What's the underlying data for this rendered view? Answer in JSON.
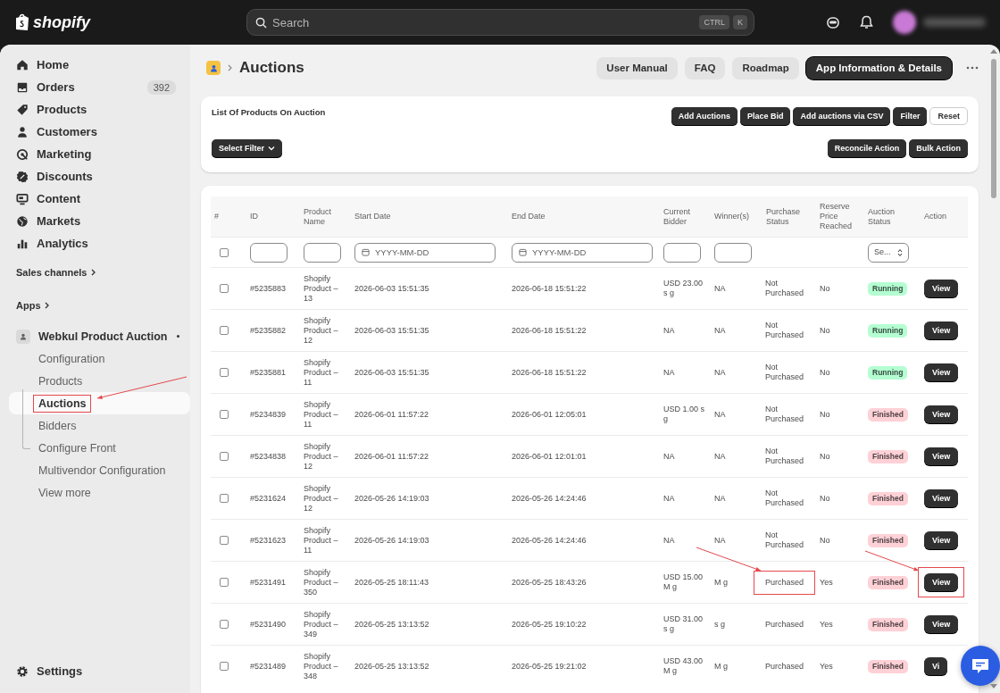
{
  "topbar": {
    "logo": "shopify",
    "search": {
      "placeholder": "Search",
      "keys": [
        "CTRL",
        "K"
      ]
    }
  },
  "sidebar": {
    "nav": [
      {
        "label": "Home"
      },
      {
        "label": "Orders",
        "badge": "392"
      },
      {
        "label": "Products"
      },
      {
        "label": "Customers"
      },
      {
        "label": "Marketing"
      },
      {
        "label": "Discounts"
      },
      {
        "label": "Content"
      },
      {
        "label": "Markets"
      },
      {
        "label": "Analytics"
      }
    ],
    "sections": [
      "Sales channels",
      "Apps"
    ],
    "app": {
      "name": "Webkul Product Auction",
      "items": [
        {
          "label": "Configuration",
          "selected": false,
          "highlighted": false
        },
        {
          "label": "Products",
          "selected": false,
          "highlighted": false
        },
        {
          "label": "Auctions",
          "selected": true,
          "highlighted": true
        },
        {
          "label": "Bidders",
          "selected": false,
          "highlighted": false
        },
        {
          "label": "Configure Front",
          "selected": false,
          "highlighted": false
        },
        {
          "label": "Multivendor Configuration",
          "selected": false,
          "highlighted": false
        },
        {
          "label": "View more",
          "selected": false,
          "highlighted": false
        }
      ]
    },
    "settings": "Settings"
  },
  "page": {
    "title": "Auctions",
    "buttons": [
      {
        "label": "User Manual",
        "kind": "secondary"
      },
      {
        "label": "FAQ",
        "kind": "secondary"
      },
      {
        "label": "Roadmap",
        "kind": "secondary"
      },
      {
        "label": "App Information & Details",
        "kind": "primary"
      }
    ]
  },
  "toolbar": {
    "title": "List Of Products On Auction",
    "buttons": [
      {
        "label": "Add Auctions",
        "kind": "dark"
      },
      {
        "label": "Place Bid",
        "kind": "dark"
      },
      {
        "label": "Add auctions via CSV",
        "kind": "dark"
      },
      {
        "label": "Filter",
        "kind": "dark"
      },
      {
        "label": "Reset",
        "kind": "light"
      }
    ],
    "filter": "Select Filter",
    "actions": [
      {
        "label": "Reconcile Action",
        "kind": "dark"
      },
      {
        "label": "Bulk Action",
        "kind": "dark"
      }
    ]
  },
  "table": {
    "columns": [
      "#",
      "ID",
      "Product Name",
      "Start Date",
      "End Date",
      "Current Bidder",
      "Winner(s)",
      "Purchase Status",
      "Reserve Price Reached",
      "Auction Status",
      "Action"
    ],
    "filters": [
      {
        "kind": "checkbox",
        "checked": false
      },
      {
        "kind": "text"
      },
      {
        "kind": "text"
      },
      {
        "kind": "date",
        "placeholder": "YYYY-MM-DD"
      },
      {
        "kind": "date",
        "placeholder": "YYYY-MM-DD"
      },
      {
        "kind": "text"
      },
      {
        "kind": "text"
      },
      {
        "kind": "none"
      },
      {
        "kind": "none"
      },
      {
        "kind": "select",
        "value": "Se..."
      },
      {
        "kind": "none"
      }
    ],
    "rows": [
      {
        "checked": false,
        "id": "#5235883",
        "product": "Shopify Product – 13",
        "start": "2026-06-03 15:51:35",
        "end": "2026-06-18 15:51:22",
        "bidder": "USD 23.00 s g",
        "winners": "NA",
        "purchase": "Not Purchased",
        "reserve": "No",
        "status": "Running",
        "color": "#b4fed2",
        "action": "View",
        "purchase_highlighted": false,
        "action_highlighted": false
      },
      {
        "checked": false,
        "id": "#5235882",
        "product": "Shopify Product – 12",
        "start": "2026-06-03 15:51:35",
        "end": "2026-06-18 15:51:22",
        "bidder": "NA",
        "winners": "NA",
        "purchase": "Not Purchased",
        "reserve": "No",
        "status": "Running",
        "color": "#b4fed2",
        "action": "View",
        "purchase_highlighted": false,
        "action_highlighted": false
      },
      {
        "checked": false,
        "id": "#5235881",
        "product": "Shopify Product – 11",
        "start": "2026-06-03 15:51:35",
        "end": "2026-06-18 15:51:22",
        "bidder": "NA",
        "winners": "NA",
        "purchase": "Not Purchased",
        "reserve": "No",
        "status": "Running",
        "color": "#b4fed2",
        "action": "View",
        "purchase_highlighted": false,
        "action_highlighted": false
      },
      {
        "checked": false,
        "id": "#5234839",
        "product": "Shopify Product – 11",
        "start": "2026-06-01 11:57:22",
        "end": "2026-06-01 12:05:01",
        "bidder": "USD 1.00 s g",
        "winners": "NA",
        "purchase": "Not Purchased",
        "reserve": "No",
        "status": "Finished",
        "color": "#fed1d7",
        "action": "View",
        "purchase_highlighted": false,
        "action_highlighted": false
      },
      {
        "checked": false,
        "id": "#5234838",
        "product": "Shopify Product – 12",
        "start": "2026-06-01 11:57:22",
        "end": "2026-06-01 12:01:01",
        "bidder": "NA",
        "winners": "NA",
        "purchase": "Not Purchased",
        "reserve": "No",
        "status": "Finished",
        "color": "#fed1d7",
        "action": "View",
        "purchase_highlighted": false,
        "action_highlighted": false
      },
      {
        "checked": false,
        "id": "#5231624",
        "product": "Shopify Product – 12",
        "start": "2026-05-26 14:19:03",
        "end": "2026-05-26 14:24:46",
        "bidder": "NA",
        "winners": "NA",
        "purchase": "Not Purchased",
        "reserve": "No",
        "status": "Finished",
        "color": "#fed1d7",
        "action": "View",
        "purchase_highlighted": false,
        "action_highlighted": false
      },
      {
        "checked": false,
        "id": "#5231623",
        "product": "Shopify Product – 11",
        "start": "2026-05-26 14:19:03",
        "end": "2026-05-26 14:24:46",
        "bidder": "NA",
        "winners": "NA",
        "purchase": "Not Purchased",
        "reserve": "No",
        "status": "Finished",
        "color": "#fed1d7",
        "action": "View",
        "purchase_highlighted": false,
        "action_highlighted": false
      },
      {
        "checked": false,
        "id": "#5231491",
        "product": "Shopify Product – 350",
        "start": "2026-05-25 18:11:43",
        "end": "2026-05-25 18:43:26",
        "bidder": "USD 15.00 M g",
        "winners": "M g",
        "purchase": "Purchased",
        "reserve": "Yes",
        "status": "Finished",
        "color": "#fed1d7",
        "action": "View",
        "purchase_highlighted": true,
        "action_highlighted": true
      },
      {
        "checked": false,
        "id": "#5231490",
        "product": "Shopify Product – 349",
        "start": "2026-05-25 13:13:52",
        "end": "2026-05-25 19:10:22",
        "bidder": "USD 31.00 s g",
        "winners": "s g",
        "purchase": "Purchased",
        "reserve": "Yes",
        "status": "Finished",
        "color": "#fed1d7",
        "action": "View",
        "purchase_highlighted": false,
        "action_highlighted": false
      },
      {
        "checked": false,
        "id": "#5231489",
        "product": "Shopify Product – 348",
        "start": "2026-05-25 13:13:52",
        "end": "2026-05-25 19:21:02",
        "bidder": "USD 43.00 M g",
        "winners": "M g",
        "purchase": "Purchased",
        "reserve": "Yes",
        "status": "Finished",
        "color": "#fed1d7",
        "action": "Vi",
        "purchase_highlighted": false,
        "action_highlighted": false
      }
    ]
  }
}
